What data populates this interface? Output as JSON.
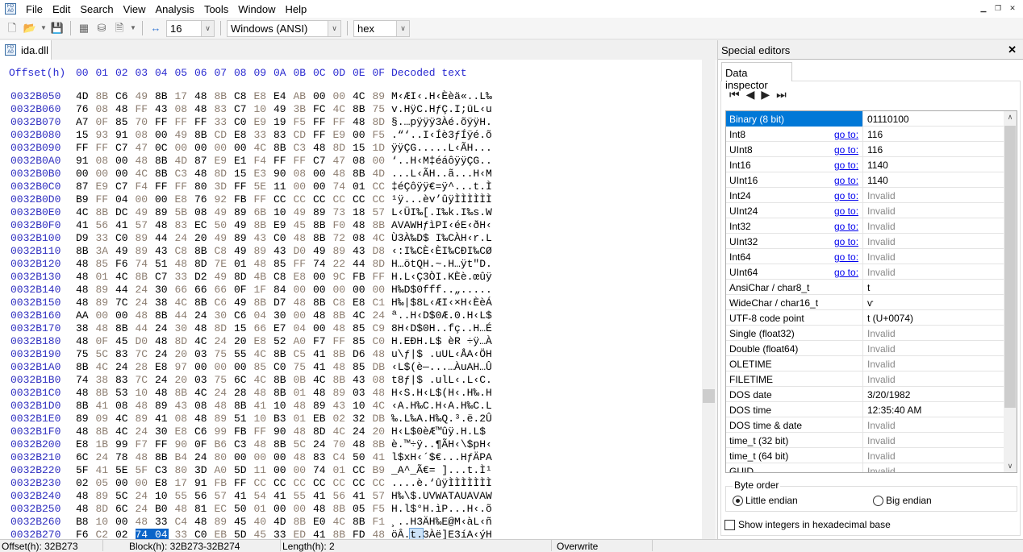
{
  "menu": [
    "File",
    "Edit",
    "Search",
    "View",
    "Analysis",
    "Tools",
    "Window",
    "Help"
  ],
  "toolbar": {
    "bytes_per_row": "16",
    "charset": "Windows (ANSI)",
    "offset_base": "hex"
  },
  "file_tab": "ida.dll",
  "editor": {
    "offset_header": "Offset(h)",
    "column_headers": [
      "00",
      "01",
      "02",
      "03",
      "04",
      "05",
      "06",
      "07",
      "08",
      "09",
      "0A",
      "0B",
      "0C",
      "0D",
      "0E",
      "0F"
    ],
    "decoded_header": "Decoded text",
    "selection": {
      "row": 34,
      "start": 3,
      "end": 4
    },
    "rows": [
      {
        "offset": "0032B050",
        "hex": "4D 8B C6 49 8B 17 48 8B C8 E8 E4 AB 00 00 4C 89",
        "text": "M‹ÆI‹.H‹Èèä«..L‰"
      },
      {
        "offset": "0032B060",
        "hex": "76 08 48 FF 43 08 48 83 C7 10 49 3B FC 4C 8B 75",
        "text": "v.HÿC.HƒÇ.I;üL‹u"
      },
      {
        "offset": "0032B070",
        "hex": "A7 0F 85 70 FF FF FF 33 C0 E9 19 F5 FF FF 48 8D",
        "text": "§.…pÿÿÿ3Àé.õÿÿH."
      },
      {
        "offset": "0032B080",
        "hex": "15 93 91 08 00 49 8B CD E8 33 83 CD FF E9 00 F5",
        "text": ".“‘..I‹Íè3ƒÍÿé.õ"
      },
      {
        "offset": "0032B090",
        "hex": "FF FF C7 47 0C 00 00 00 00 4C 8B C3 48 8D 15 1D",
        "text": "ÿÿÇG.....L‹ÃH..."
      },
      {
        "offset": "0032B0A0",
        "hex": "91 08 00 48 8B 4D 87 E9 E1 F4 FF FF C7 47 08 00",
        "text": "‘..H‹M‡éáôÿÿÇG.."
      },
      {
        "offset": "0032B0B0",
        "hex": "00 00 00 4C 8B C3 48 8D 15 E3 90 08 00 48 8B 4D",
        "text": "...L‹ÃH..ã...H‹M"
      },
      {
        "offset": "0032B0C0",
        "hex": "87 E9 C7 F4 FF FF 80 3D FF 5E 11 00 00 74 01 CC",
        "text": "‡éÇôÿÿ€=ÿ^...t.Ì"
      },
      {
        "offset": "0032B0D0",
        "hex": "B9 FF 04 00 00 E8 76 92 FB FF CC CC CC CC CC CC",
        "text": "¹ÿ...èv’ûÿÌÌÌÌÌÌ"
      },
      {
        "offset": "0032B0E0",
        "hex": "4C 8B DC 49 89 5B 08 49 89 6B 10 49 89 73 18 57",
        "text": "L‹ÜI‰[.I‰k.I‰s.W"
      },
      {
        "offset": "0032B0F0",
        "hex": "41 56 41 57 48 83 EC 50 49 8B E9 45 8B F0 48 8B",
        "text": "AVAWHƒìPI‹éE‹ðH‹"
      },
      {
        "offset": "0032B100",
        "hex": "D9 33 C0 89 44 24 20 49 89 43 C0 48 8B 72 08 4C",
        "text": "Ù3À‰D$ I‰CÀH‹r.L"
      },
      {
        "offset": "0032B110",
        "hex": "8B 3A 49 89 43 C8 8B C8 49 89 43 D0 49 89 43 D8",
        "text": "‹:I‰CÈ‹ÈI‰CÐI‰CØ"
      },
      {
        "offset": "0032B120",
        "hex": "48 85 F6 74 51 48 8D 7E 01 48 85 FF 74 22 44 8D",
        "text": "H…ötQH.~.H…ÿt\"D."
      },
      {
        "offset": "0032B130",
        "hex": "48 01 4C 8B C7 33 D2 49 8D 4B C8 E8 00 9C FB FF",
        "text": "H.L‹Ç3ÒI.KÈè.œûÿ"
      },
      {
        "offset": "0032B140",
        "hex": "48 89 44 24 30 66 66 66 0F 1F 84 00 00 00 00 00",
        "text": "H‰D$0fff..„....."
      },
      {
        "offset": "0032B150",
        "hex": "48 89 7C 24 38 4C 8B C6 49 8B D7 48 8B C8 E8 C1",
        "text": "H‰|$8L‹ÆI‹×H‹ÈèÁ"
      },
      {
        "offset": "0032B160",
        "hex": "AA 00 00 48 8B 44 24 30 C6 04 30 00 48 8B 4C 24",
        "text": "ª..H‹D$0Æ.0.H‹L$"
      },
      {
        "offset": "0032B170",
        "hex": "38 48 8B 44 24 30 48 8D 15 66 E7 04 00 48 85 C9",
        "text": "8H‹D$0H..fç..H…É"
      },
      {
        "offset": "0032B180",
        "hex": "48 0F 45 D0 48 8D 4C 24 20 E8 52 A0 F7 FF 85 C0",
        "text": "H.EÐH.L$ èR ÷ÿ…À"
      },
      {
        "offset": "0032B190",
        "hex": "75 5C 83 7C 24 20 03 75 55 4C 8B C5 41 8B D6 48",
        "text": "u\\ƒ|$ .uUL‹ÅA‹ÖH"
      },
      {
        "offset": "0032B1A0",
        "hex": "8B 4C 24 28 E8 97 00 00 00 85 C0 75 41 48 85 DB",
        "text": "‹L$(è—...…ÀuAH…Û"
      },
      {
        "offset": "0032B1B0",
        "hex": "74 38 83 7C 24 20 03 75 6C 4C 8B 0B 4C 8B 43 08",
        "text": "t8ƒ|$ .ulL‹.L‹C."
      },
      {
        "offset": "0032B1C0",
        "hex": "48 8B 53 10 48 8B 4C 24 28 48 8B 01 48 89 03 48",
        "text": "H‹S.H‹L$(H‹.H‰.H"
      },
      {
        "offset": "0032B1D0",
        "hex": "8B 41 08 48 89 43 08 48 8B 41 10 48 89 43 10 4C",
        "text": "‹A.H‰C.H‹A.H‰C.L"
      },
      {
        "offset": "0032B1E0",
        "hex": "89 09 4C 89 41 08 48 89 51 10 B3 01 EB 02 32 DB",
        "text": "‰.L‰A.H‰Q.³.ë.2Û"
      },
      {
        "offset": "0032B1F0",
        "hex": "48 8B 4C 24 30 E8 C6 99 FB FF 90 48 8D 4C 24 20",
        "text": "H‹L$0èÆ™ûÿ.H.L$ "
      },
      {
        "offset": "0032B200",
        "hex": "E8 1B 99 F7 FF 90 0F B6 C3 48 8B 5C 24 70 48 8B",
        "text": "è.™÷ÿ..¶ÃH‹\\$pH‹"
      },
      {
        "offset": "0032B210",
        "hex": "6C 24 78 48 8B B4 24 80 00 00 00 48 83 C4 50 41",
        "text": "l$xH‹´$€...HƒÄPA"
      },
      {
        "offset": "0032B220",
        "hex": "5F 41 5E 5F C3 80 3D A0 5D 11 00 00 74 01 CC B9",
        "text": "_A^_Ã€= ]...t.Ì¹"
      },
      {
        "offset": "0032B230",
        "hex": "02 05 00 00 E8 17 91 FB FF CC CC CC CC CC CC CC",
        "text": "....è.‘ûÿÌÌÌÌÌÌÌ"
      },
      {
        "offset": "0032B240",
        "hex": "48 89 5C 24 10 55 56 57 41 54 41 55 41 56 41 57",
        "text": "H‰\\$.UVWATAUAVAW"
      },
      {
        "offset": "0032B250",
        "hex": "48 8D 6C 24 B0 48 81 EC 50 01 00 00 48 8B 05 F5",
        "text": "H.l$°H.ìP...H‹.õ"
      },
      {
        "offset": "0032B260",
        "hex": "B8 10 00 48 33 C4 48 89 45 40 4D 8B E0 4C 8B F1",
        "text": "¸..H3ÄH‰E@M‹àL‹ñ"
      },
      {
        "offset": "0032B270",
        "hex": "F6 C2 02 74 04 33 C0 EB 5D 45 33 ED 41 8B FD 48",
        "text": "öÂ.t.3Àë]E3íA‹ýH"
      }
    ]
  },
  "status": {
    "offset": "Offset(h): 32B273",
    "block": "Block(h): 32B273-32B274",
    "length": "Length(h): 2",
    "mode": "Overwrite"
  },
  "panel": {
    "title": "Special editors",
    "tab": "Data inspector",
    "goto_label": "go to:",
    "rows": [
      {
        "label": "Binary (8 bit)",
        "value": "01110100",
        "goto": false,
        "invalid": false,
        "selected": true
      },
      {
        "label": "Int8",
        "value": "116",
        "goto": true,
        "invalid": false
      },
      {
        "label": "UInt8",
        "value": "116",
        "goto": true,
        "invalid": false
      },
      {
        "label": "Int16",
        "value": "1140",
        "goto": true,
        "invalid": false
      },
      {
        "label": "UInt16",
        "value": "1140",
        "goto": true,
        "invalid": false
      },
      {
        "label": "Int24",
        "value": "Invalid",
        "goto": true,
        "invalid": true
      },
      {
        "label": "UInt24",
        "value": "Invalid",
        "goto": true,
        "invalid": true
      },
      {
        "label": "Int32",
        "value": "Invalid",
        "goto": true,
        "invalid": true
      },
      {
        "label": "UInt32",
        "value": "Invalid",
        "goto": true,
        "invalid": true
      },
      {
        "label": "Int64",
        "value": "Invalid",
        "goto": true,
        "invalid": true
      },
      {
        "label": "UInt64",
        "value": "Invalid",
        "goto": true,
        "invalid": true
      },
      {
        "label": "AnsiChar / char8_t",
        "value": "t",
        "goto": false,
        "invalid": false
      },
      {
        "label": "WideChar / char16_t",
        "value": "ѵ",
        "goto": false,
        "invalid": false
      },
      {
        "label": "UTF-8 code point",
        "value": "t (U+0074)",
        "goto": false,
        "invalid": false
      },
      {
        "label": "Single (float32)",
        "value": "Invalid",
        "goto": false,
        "invalid": true
      },
      {
        "label": "Double (float64)",
        "value": "Invalid",
        "goto": false,
        "invalid": true
      },
      {
        "label": "OLETIME",
        "value": "Invalid",
        "goto": false,
        "invalid": true
      },
      {
        "label": "FILETIME",
        "value": "Invalid",
        "goto": false,
        "invalid": true
      },
      {
        "label": "DOS date",
        "value": "3/20/1982",
        "goto": false,
        "invalid": false
      },
      {
        "label": "DOS time",
        "value": "12:35:40 AM",
        "goto": false,
        "invalid": false
      },
      {
        "label": "DOS time & date",
        "value": "Invalid",
        "goto": false,
        "invalid": true
      },
      {
        "label": "time_t (32 bit)",
        "value": "Invalid",
        "goto": false,
        "invalid": true
      },
      {
        "label": "time_t (64 bit)",
        "value": "Invalid",
        "goto": false,
        "invalid": true
      },
      {
        "label": "GUID",
        "value": "Invalid",
        "goto": false,
        "invalid": true
      }
    ],
    "byte_order_label": "Byte order",
    "little_endian": "Little endian",
    "big_endian": "Big endian",
    "byte_order_selected": "little",
    "hex_checkbox": "Show integers in hexadecimal base",
    "hex_checked": false
  }
}
